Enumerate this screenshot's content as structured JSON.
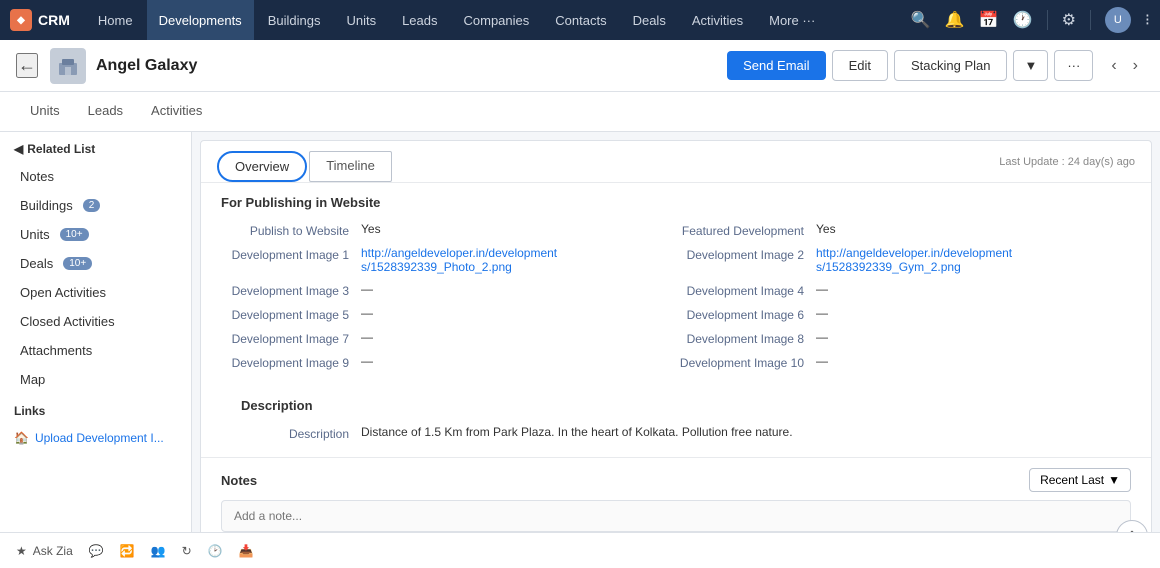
{
  "app": {
    "logo_text": "CRM",
    "logo_abbr": "Z"
  },
  "top_nav": {
    "items": [
      {
        "label": "Home",
        "active": false
      },
      {
        "label": "Developments",
        "active": true
      },
      {
        "label": "Buildings",
        "active": false
      },
      {
        "label": "Units",
        "active": false
      },
      {
        "label": "Leads",
        "active": false
      },
      {
        "label": "Companies",
        "active": false
      },
      {
        "label": "Contacts",
        "active": false
      },
      {
        "label": "Deals",
        "active": false
      },
      {
        "label": "Activities",
        "active": false
      },
      {
        "label": "More",
        "active": false
      }
    ]
  },
  "header": {
    "back_label": "←",
    "title": "Angel Galaxy",
    "send_email_label": "Send Email",
    "edit_label": "Edit",
    "stacking_plan_label": "Stacking Plan",
    "more_label": "···",
    "prev_label": "‹",
    "next_label": "›"
  },
  "sub_tabs": [
    {
      "label": "Units",
      "active": false
    },
    {
      "label": "Leads",
      "active": false
    },
    {
      "label": "Activities",
      "active": false
    }
  ],
  "sidebar": {
    "related_list_label": "Related List",
    "items": [
      {
        "label": "Notes",
        "badge": null
      },
      {
        "label": "Buildings",
        "badge": "2"
      },
      {
        "label": "Units",
        "badge": "10+"
      },
      {
        "label": "Deals",
        "badge": "10+"
      },
      {
        "label": "Open Activities",
        "badge": null
      },
      {
        "label": "Closed Activities",
        "badge": null
      },
      {
        "label": "Attachments",
        "badge": null
      },
      {
        "label": "Map",
        "badge": null
      }
    ],
    "links_label": "Links",
    "link_items": [
      {
        "label": "Upload Development I..."
      }
    ]
  },
  "view_tabs": [
    {
      "label": "Overview",
      "active": true
    },
    {
      "label": "Timeline",
      "active": false
    }
  ],
  "last_update": "Last Update : 24 day(s) ago",
  "publishing_section": {
    "title": "For Publishing in Website",
    "fields_left": [
      {
        "label": "Publish to Website",
        "value": "Yes",
        "type": "plain"
      },
      {
        "label": "Development Image 1",
        "value": "http://angeldeveloper.in/developments/1528392339_Photo_2.png",
        "type": "link"
      },
      {
        "label": "Development Image 3",
        "value": "—",
        "type": "plain"
      },
      {
        "label": "Development Image 5",
        "value": "—",
        "type": "plain"
      },
      {
        "label": "Development Image 7",
        "value": "—",
        "type": "plain"
      },
      {
        "label": "Development Image 9",
        "value": "—",
        "type": "plain"
      }
    ],
    "fields_right": [
      {
        "label": "Featured Development",
        "value": "Yes",
        "type": "plain"
      },
      {
        "label": "Development Image 2",
        "value": "http://angeldeveloper.in/developments/1528392339_Gym_2.png",
        "type": "link"
      },
      {
        "label": "Development Image 4",
        "value": "—",
        "type": "plain"
      },
      {
        "label": "Development Image 6",
        "value": "—",
        "type": "plain"
      },
      {
        "label": "Development Image 8",
        "value": "—",
        "type": "plain"
      },
      {
        "label": "Development Image 10",
        "value": "—",
        "type": "plain"
      }
    ]
  },
  "description_section": {
    "title": "Description",
    "fields": [
      {
        "label": "Description",
        "value": "Distance of 1.5 Km from Park Plaza. In the heart of Kolkata. Pollution free nature.",
        "type": "plain"
      }
    ]
  },
  "notes_section": {
    "title": "Notes",
    "filter_label": "Recent Last",
    "placeholder": "Add a note..."
  },
  "bottom_bar": {
    "items": [
      {
        "label": "Ask Zia"
      },
      {
        "label": ""
      },
      {
        "label": ""
      },
      {
        "label": ""
      },
      {
        "label": ""
      },
      {
        "label": ""
      },
      {
        "label": ""
      }
    ]
  }
}
